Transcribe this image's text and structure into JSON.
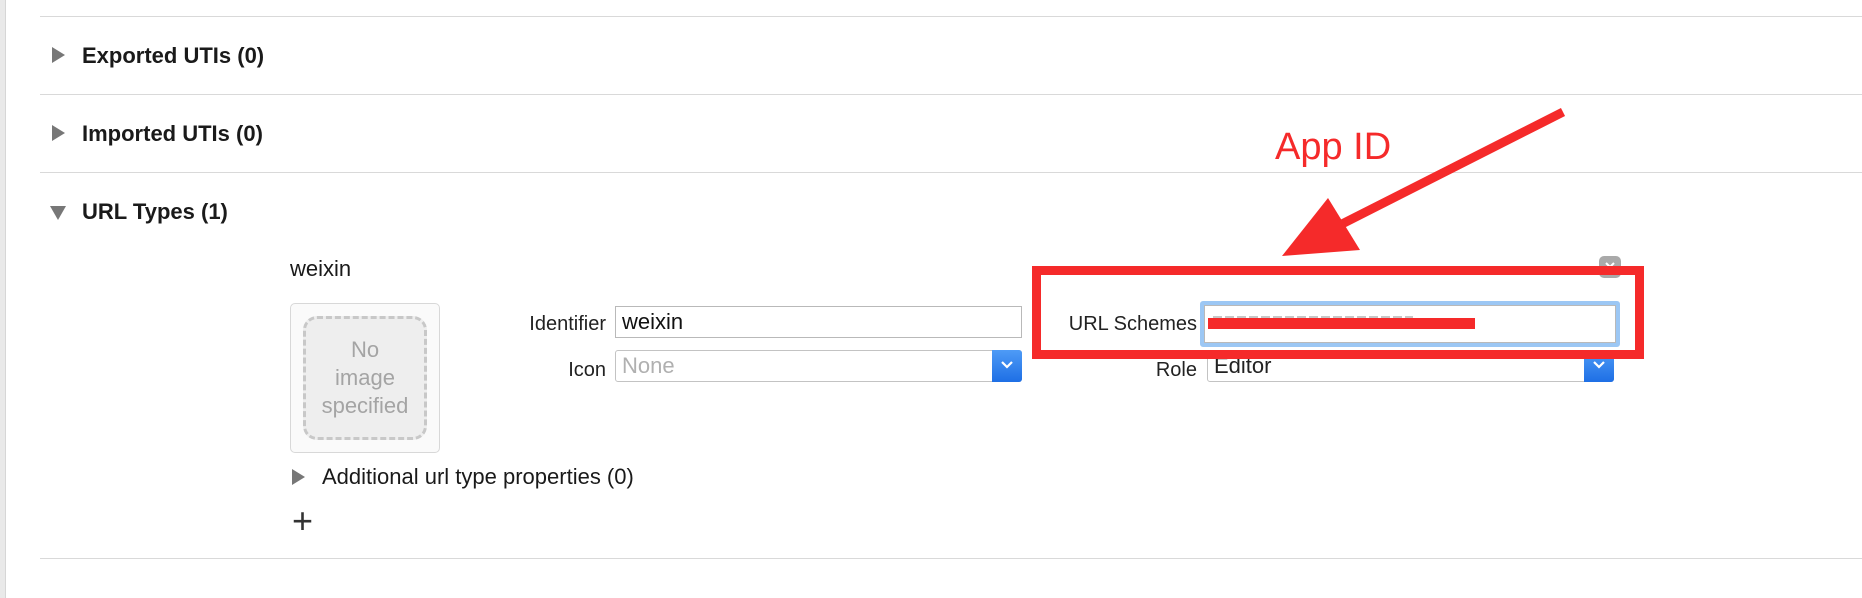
{
  "sections": {
    "exported_utis": "Exported UTIs (0)",
    "imported_utis": "Imported UTIs (0)",
    "url_types": "URL Types (1)"
  },
  "url_type": {
    "name": "weixin",
    "image_placeholder": "No image specified",
    "identifier_label": "Identifier",
    "identifier_value": "weixin",
    "icon_label": "Icon",
    "icon_value": "None",
    "url_schemes_label": "URL Schemes",
    "role_label": "Role",
    "role_value": "Editor",
    "additional_properties": "Additional url type properties (0)",
    "add_symbol": "+"
  },
  "annotation": {
    "text": "App ID",
    "color": "#f52a2a"
  },
  "colors": {
    "popup_button": "#2f80ed",
    "focus_ring": "#9cc7f4"
  }
}
